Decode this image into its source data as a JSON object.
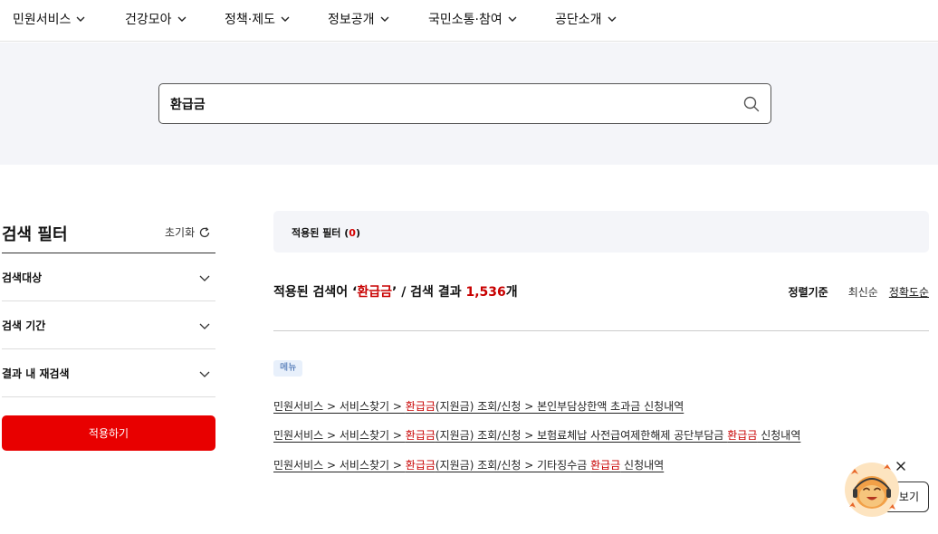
{
  "nav": {
    "items": [
      {
        "label": "민원서비스"
      },
      {
        "label": "건강모아"
      },
      {
        "label": "정책·제도"
      },
      {
        "label": "정보공개"
      },
      {
        "label": "국민소통·참여"
      },
      {
        "label": "공단소개"
      }
    ]
  },
  "search": {
    "value": "환급금"
  },
  "filter": {
    "title": "검색 필터",
    "reset_label": "초기화",
    "rows": [
      {
        "label": "검색대상"
      },
      {
        "label": "검색 기간"
      },
      {
        "label": "결과 내 재검색"
      }
    ],
    "apply_label": "적용하기"
  },
  "applied": {
    "label": "적용된 필터 (",
    "count": "0",
    "close": ")"
  },
  "result": {
    "prefix": "적용된 검색어 ‘",
    "keyword": "환급금",
    "middle": "’ / 검색 결과 ",
    "count": "1,536",
    "suffix": "개"
  },
  "sort": {
    "label": "정렬기준",
    "options": [
      {
        "label": "최신순",
        "active": false
      },
      {
        "label": "정확도순",
        "active": true
      }
    ]
  },
  "category_badge": "메뉴",
  "links": [
    {
      "a": "민원서비스 > 서비스찾기 > ",
      "b": "환급금",
      "c": "(지원금) 조회/신청 > 본인부담상한액 초과금 신청내역",
      "d": "",
      "e": ""
    },
    {
      "a": "민원서비스 > 서비스찾기 > ",
      "b": "환급금",
      "c": "(지원금) 조회/신청 > 보험료체납 사전급여제한해제 공단부담금 ",
      "d": "환급금",
      "e": " 신청내역"
    },
    {
      "a": "민원서비스 > 서비스찾기 > ",
      "b": "환급금",
      "c": "(지원금) 조회/신청 > 기타징수금 ",
      "d": "환급금",
      "e": " 신청내역"
    }
  ],
  "chatbot": {
    "view_label": "보기"
  },
  "colors": {
    "accent_red": "#e80000",
    "highlight_red": "#c80000",
    "band_bg": "#f4f5f9"
  }
}
